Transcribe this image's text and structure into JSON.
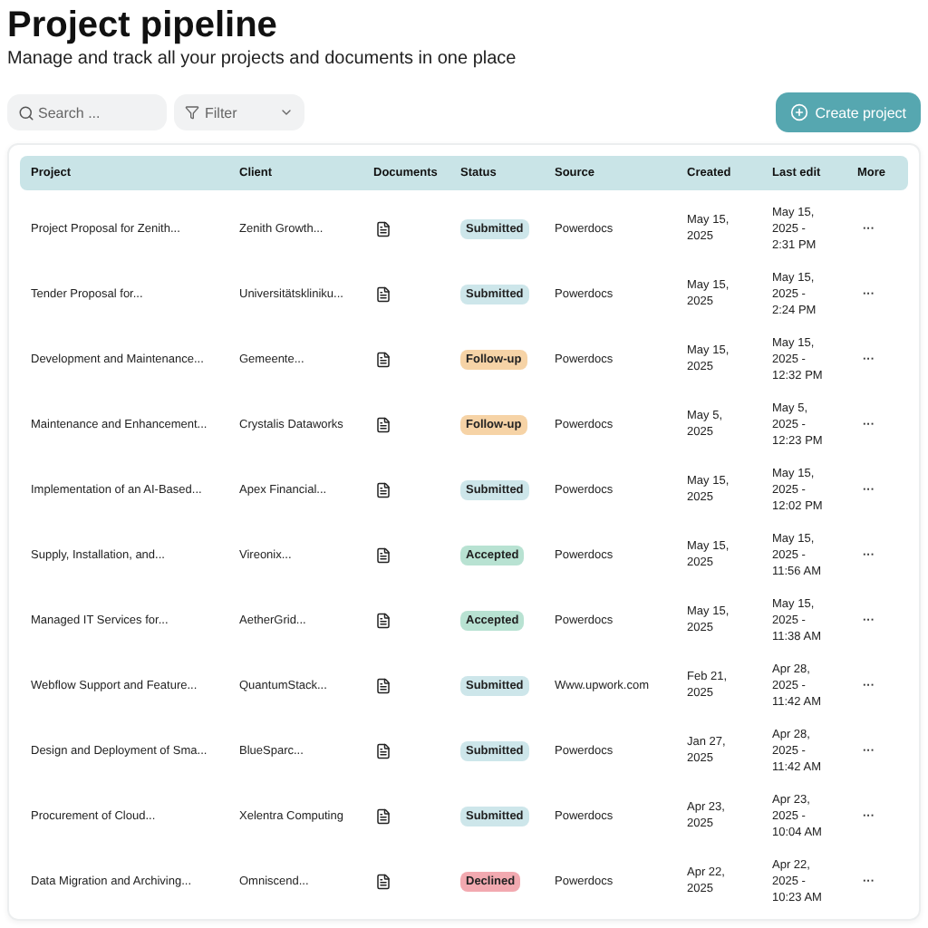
{
  "title": "Project pipeline",
  "subtitle": "Manage and track all your projects and documents in one place",
  "search": {
    "placeholder": "Search ..."
  },
  "filter": {
    "label": "Filter"
  },
  "create_button": "Create project",
  "table": {
    "columns": [
      "Project",
      "Client",
      "Documents",
      "Status",
      "Source",
      "Created",
      "Last edit",
      "More"
    ],
    "rows": [
      {
        "project": "Project Proposal for Zenith...",
        "client": "Zenith Growth...",
        "status": "Submitted",
        "source": "Powerdocs",
        "created": "May 15, 2025",
        "last_edit": "May 15, 2025 - 2:31 PM",
        "more": "···"
      },
      {
        "project": "Tender Proposal for...",
        "client": "Universitätskliniku...",
        "status": "Submitted",
        "source": "Powerdocs",
        "created": "May 15, 2025",
        "last_edit": "May 15, 2025 - 2:24 PM",
        "more": "···"
      },
      {
        "project": "Development and Maintenance...",
        "client": "Gemeente...",
        "status": "Follow-up",
        "source": "Powerdocs",
        "created": "May 15, 2025",
        "last_edit": "May 15, 2025 - 12:32 PM",
        "more": "···"
      },
      {
        "project": "Maintenance and Enhancement...",
        "client": "Crystalis Dataworks",
        "status": "Follow-up",
        "source": "Powerdocs",
        "created": "May 5, 2025",
        "last_edit": "May 5, 2025 - 12:23 PM",
        "more": "···"
      },
      {
        "project": "Implementation of an AI-Based...",
        "client": "Apex Financial...",
        "status": "Submitted",
        "source": "Powerdocs",
        "created": "May 15, 2025",
        "last_edit": "May 15, 2025 - 12:02 PM",
        "more": "···"
      },
      {
        "project": "Supply, Installation, and...",
        "client": "Vireonix...",
        "status": "Accepted",
        "source": "Powerdocs",
        "created": "May 15, 2025",
        "last_edit": "May 15, 2025 - 11:56 AM",
        "more": "···"
      },
      {
        "project": "Managed IT Services for...",
        "client": "AetherGrid...",
        "status": "Accepted",
        "source": "Powerdocs",
        "created": "May 15, 2025",
        "last_edit": "May 15, 2025 - 11:38 AM",
        "more": "···"
      },
      {
        "project": "Webflow Support and Feature...",
        "client": "QuantumStack...",
        "status": "Submitted",
        "source": "Www.upwork.com",
        "created": "Feb 21, 2025",
        "last_edit": "Apr 28, 2025 - 11:42 AM",
        "more": "···"
      },
      {
        "project": "Design and Deployment of Sma...",
        "client": "BlueSparc...",
        "status": "Submitted",
        "source": "Powerdocs",
        "created": "Jan 27, 2025",
        "last_edit": "Apr 28, 2025 - 11:42 AM",
        "more": "···"
      },
      {
        "project": "Procurement of Cloud...",
        "client": "Xelentra Computing",
        "status": "Submitted",
        "source": "Powerdocs",
        "created": "Apr 23, 2025",
        "last_edit": "Apr 23, 2025 - 10:04 AM",
        "more": "···"
      },
      {
        "project": "Data Migration and Archiving...",
        "client": "Omniscend...",
        "status": "Declined",
        "source": "Powerdocs",
        "created": "Apr 22, 2025",
        "last_edit": "Apr 22, 2025 - 10:23 AM",
        "more": "···"
      }
    ]
  }
}
